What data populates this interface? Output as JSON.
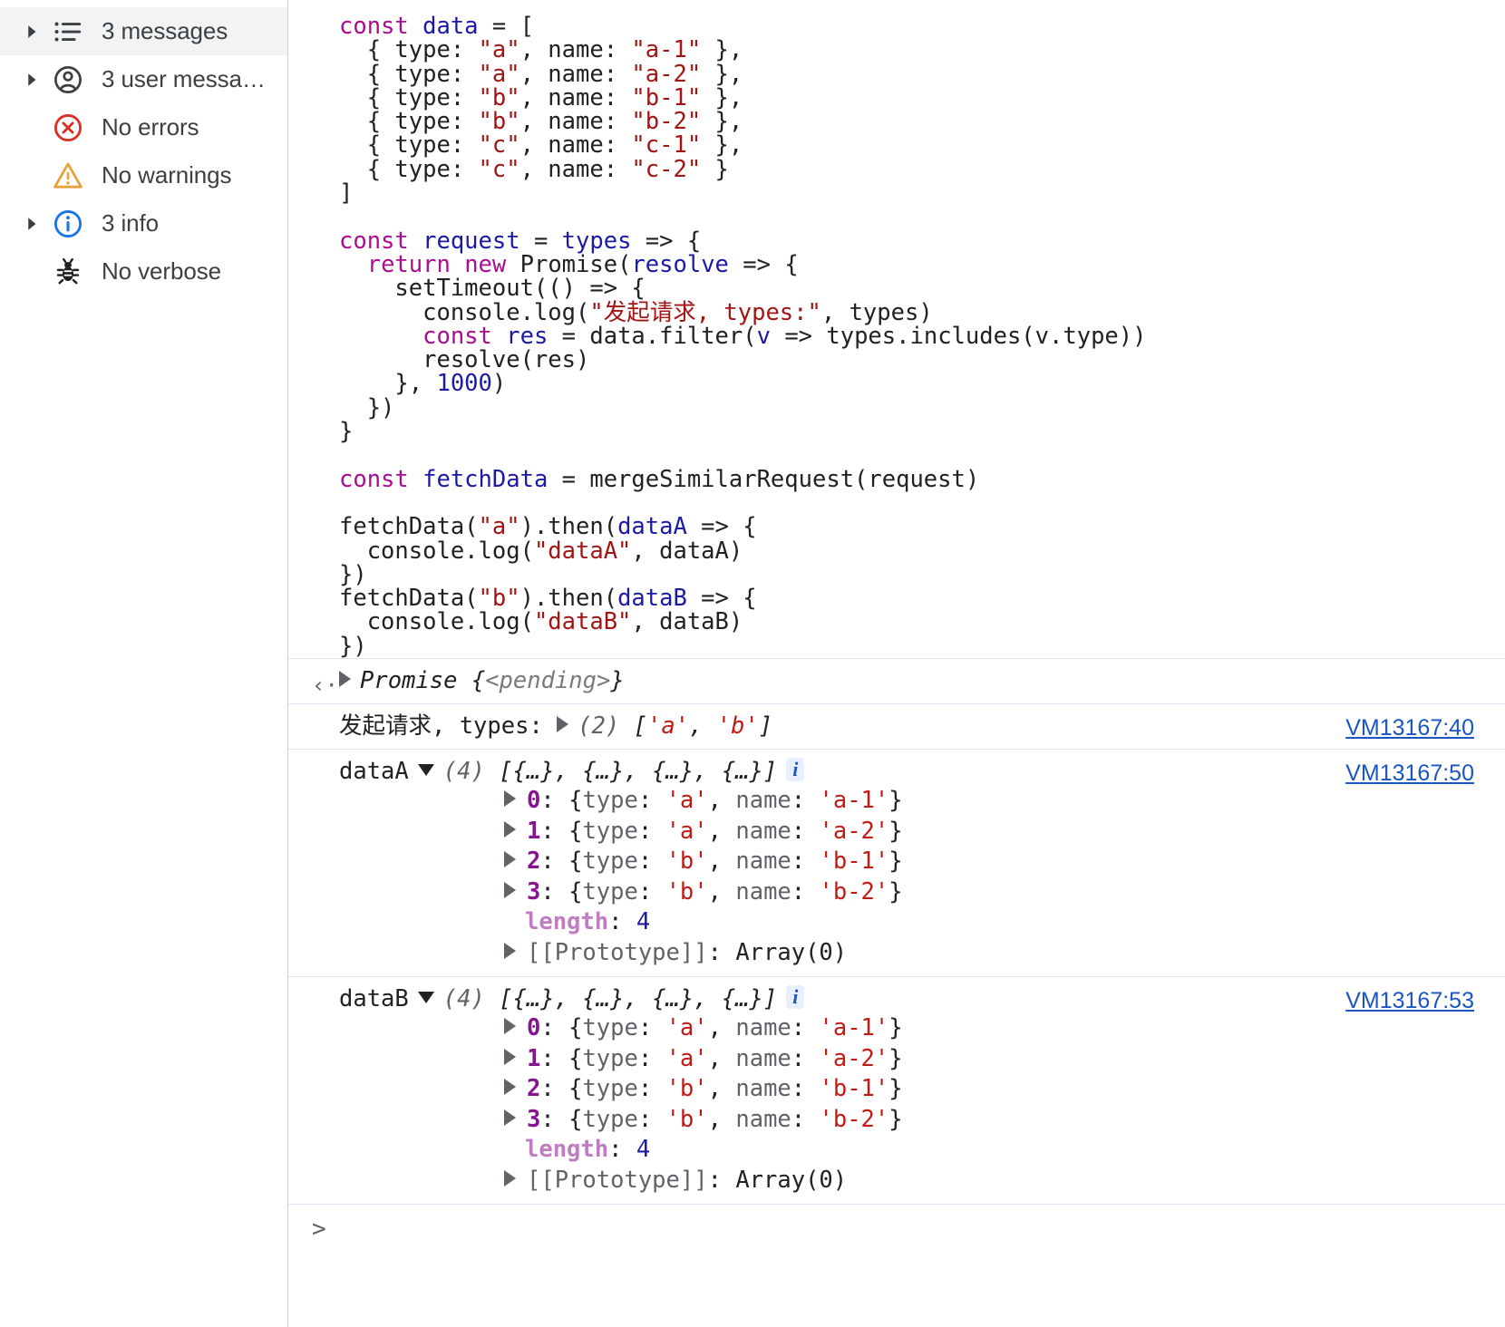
{
  "sidebar": {
    "items": [
      {
        "label": "3 messages",
        "icon": "list-icon",
        "arrow": true,
        "selected": true
      },
      {
        "label": "3 user messa…",
        "icon": "user-icon",
        "arrow": true,
        "selected": false
      },
      {
        "label": "No errors",
        "icon": "error-icon",
        "arrow": false,
        "selected": false
      },
      {
        "label": "No warnings",
        "icon": "warning-icon",
        "arrow": false,
        "selected": false
      },
      {
        "label": "3 info",
        "icon": "info-icon",
        "arrow": true,
        "selected": false
      },
      {
        "label": "No verbose",
        "icon": "bug-icon",
        "arrow": false,
        "selected": false
      }
    ]
  },
  "colors": {
    "keyword": "#aa0d91",
    "identifier": "#1a1aa6",
    "string": "#a31515",
    "link": "#1a55c4",
    "index": "#881391",
    "property": "#5f6368",
    "string_value": "#c41a16",
    "length_key": "#c17dc1",
    "selected_row": "#f1f3f4",
    "error": "#d93025",
    "warning": "#e8a33d",
    "info": "#1a73e8"
  },
  "code": {
    "lines": [
      [
        {
          "t": "const",
          "c": "kw"
        },
        {
          "t": " ",
          "c": "plain"
        },
        {
          "t": "data",
          "c": "ident"
        },
        {
          "t": " = [",
          "c": "plain"
        }
      ],
      [
        {
          "t": "  { type: ",
          "c": "plain"
        },
        {
          "t": "\"a\"",
          "c": "str"
        },
        {
          "t": ", name: ",
          "c": "plain"
        },
        {
          "t": "\"a-1\"",
          "c": "str"
        },
        {
          "t": " },",
          "c": "plain"
        }
      ],
      [
        {
          "t": "  { type: ",
          "c": "plain"
        },
        {
          "t": "\"a\"",
          "c": "str"
        },
        {
          "t": ", name: ",
          "c": "plain"
        },
        {
          "t": "\"a-2\"",
          "c": "str"
        },
        {
          "t": " },",
          "c": "plain"
        }
      ],
      [
        {
          "t": "  { type: ",
          "c": "plain"
        },
        {
          "t": "\"b\"",
          "c": "str"
        },
        {
          "t": ", name: ",
          "c": "plain"
        },
        {
          "t": "\"b-1\"",
          "c": "str"
        },
        {
          "t": " },",
          "c": "plain"
        }
      ],
      [
        {
          "t": "  { type: ",
          "c": "plain"
        },
        {
          "t": "\"b\"",
          "c": "str"
        },
        {
          "t": ", name: ",
          "c": "plain"
        },
        {
          "t": "\"b-2\"",
          "c": "str"
        },
        {
          "t": " },",
          "c": "plain"
        }
      ],
      [
        {
          "t": "  { type: ",
          "c": "plain"
        },
        {
          "t": "\"c\"",
          "c": "str"
        },
        {
          "t": ", name: ",
          "c": "plain"
        },
        {
          "t": "\"c-1\"",
          "c": "str"
        },
        {
          "t": " },",
          "c": "plain"
        }
      ],
      [
        {
          "t": "  { type: ",
          "c": "plain"
        },
        {
          "t": "\"c\"",
          "c": "str"
        },
        {
          "t": ", name: ",
          "c": "plain"
        },
        {
          "t": "\"c-2\"",
          "c": "str"
        },
        {
          "t": " }",
          "c": "plain"
        }
      ],
      [
        {
          "t": "]",
          "c": "plain"
        }
      ],
      [
        {
          "t": " ",
          "c": "plain"
        }
      ],
      [
        {
          "t": "const",
          "c": "kw"
        },
        {
          "t": " ",
          "c": "plain"
        },
        {
          "t": "request",
          "c": "ident"
        },
        {
          "t": " = ",
          "c": "plain"
        },
        {
          "t": "types",
          "c": "ident"
        },
        {
          "t": " => {",
          "c": "plain"
        }
      ],
      [
        {
          "t": "  ",
          "c": "plain"
        },
        {
          "t": "return",
          "c": "kw"
        },
        {
          "t": " ",
          "c": "plain"
        },
        {
          "t": "new",
          "c": "kw"
        },
        {
          "t": " Promise(",
          "c": "plain"
        },
        {
          "t": "resolve",
          "c": "ident"
        },
        {
          "t": " => {",
          "c": "plain"
        }
      ],
      [
        {
          "t": "    setTimeout(() => {",
          "c": "plain"
        }
      ],
      [
        {
          "t": "      console.log(",
          "c": "plain"
        },
        {
          "t": "\"发起请求, types:\"",
          "c": "str"
        },
        {
          "t": ", types)",
          "c": "plain"
        }
      ],
      [
        {
          "t": "      ",
          "c": "plain"
        },
        {
          "t": "const",
          "c": "kw"
        },
        {
          "t": " ",
          "c": "plain"
        },
        {
          "t": "res",
          "c": "ident"
        },
        {
          "t": " = data.filter(",
          "c": "plain"
        },
        {
          "t": "v",
          "c": "ident"
        },
        {
          "t": " => types.includes(v.type))",
          "c": "plain"
        }
      ],
      [
        {
          "t": "      resolve(res)",
          "c": "plain"
        }
      ],
      [
        {
          "t": "    }, ",
          "c": "plain"
        },
        {
          "t": "1000",
          "c": "num"
        },
        {
          "t": ")",
          "c": "plain"
        }
      ],
      [
        {
          "t": "  })",
          "c": "plain"
        }
      ],
      [
        {
          "t": "}",
          "c": "plain"
        }
      ],
      [
        {
          "t": " ",
          "c": "plain"
        }
      ],
      [
        {
          "t": "const",
          "c": "kw"
        },
        {
          "t": " ",
          "c": "plain"
        },
        {
          "t": "fetchData",
          "c": "ident"
        },
        {
          "t": " = mergeSimilarRequest(request)",
          "c": "plain"
        }
      ],
      [
        {
          "t": " ",
          "c": "plain"
        }
      ],
      [
        {
          "t": "fetchData(",
          "c": "plain"
        },
        {
          "t": "\"a\"",
          "c": "str"
        },
        {
          "t": ").then(",
          "c": "plain"
        },
        {
          "t": "dataA",
          "c": "ident"
        },
        {
          "t": " => {",
          "c": "plain"
        }
      ],
      [
        {
          "t": "  console.log(",
          "c": "plain"
        },
        {
          "t": "\"dataA\"",
          "c": "str"
        },
        {
          "t": ", dataA)",
          "c": "plain"
        }
      ],
      [
        {
          "t": "})",
          "c": "plain"
        }
      ],
      [
        {
          "t": "fetchData(",
          "c": "plain"
        },
        {
          "t": "\"b\"",
          "c": "str"
        },
        {
          "t": ").then(",
          "c": "plain"
        },
        {
          "t": "dataB",
          "c": "ident"
        },
        {
          "t": " => {",
          "c": "plain"
        }
      ],
      [
        {
          "t": "  console.log(",
          "c": "plain"
        },
        {
          "t": "\"dataB\"",
          "c": "str"
        },
        {
          "t": ", dataB)",
          "c": "plain"
        }
      ],
      [
        {
          "t": "})",
          "c": "plain"
        }
      ]
    ]
  },
  "output": {
    "result": {
      "return_glyph": "‹·",
      "type_name": "Promise",
      "value": "{<pending>}",
      "pending_text": "<pending>"
    },
    "log_request": {
      "message": "发起请求, types:",
      "count": "(2)",
      "preview_open": "[",
      "items": [
        "'a'",
        "'b'"
      ],
      "preview_close": "]",
      "source": "VM13167:40"
    },
    "groups": [
      {
        "label": "dataA",
        "count": "(4)",
        "preview": "[{…}, {…}, {…}, {…}]",
        "badge": "i",
        "source": "VM13167:50",
        "entries": [
          {
            "index": "0",
            "type": "'a'",
            "name": "'a-1'"
          },
          {
            "index": "1",
            "type": "'a'",
            "name": "'a-2'"
          },
          {
            "index": "2",
            "type": "'b'",
            "name": "'b-1'"
          },
          {
            "index": "3",
            "type": "'b'",
            "name": "'b-2'"
          }
        ],
        "length_key": "length",
        "length_value": "4",
        "proto_key": "[[Prototype]]",
        "proto_value": "Array(0)"
      },
      {
        "label": "dataB",
        "count": "(4)",
        "preview": "[{…}, {…}, {…}, {…}]",
        "badge": "i",
        "source": "VM13167:53",
        "entries": [
          {
            "index": "0",
            "type": "'a'",
            "name": "'a-1'"
          },
          {
            "index": "1",
            "type": "'a'",
            "name": "'a-2'"
          },
          {
            "index": "2",
            "type": "'b'",
            "name": "'b-1'"
          },
          {
            "index": "3",
            "type": "'b'",
            "name": "'b-2'"
          }
        ],
        "length_key": "length",
        "length_value": "4",
        "proto_key": "[[Prototype]]",
        "proto_value": "Array(0)"
      }
    ],
    "prompt": ">"
  },
  "labels": {
    "prop_type": "type",
    "prop_name": "name",
    "obj_open": "{",
    "obj_close": "}",
    "colon": ":",
    "comma": ", "
  }
}
